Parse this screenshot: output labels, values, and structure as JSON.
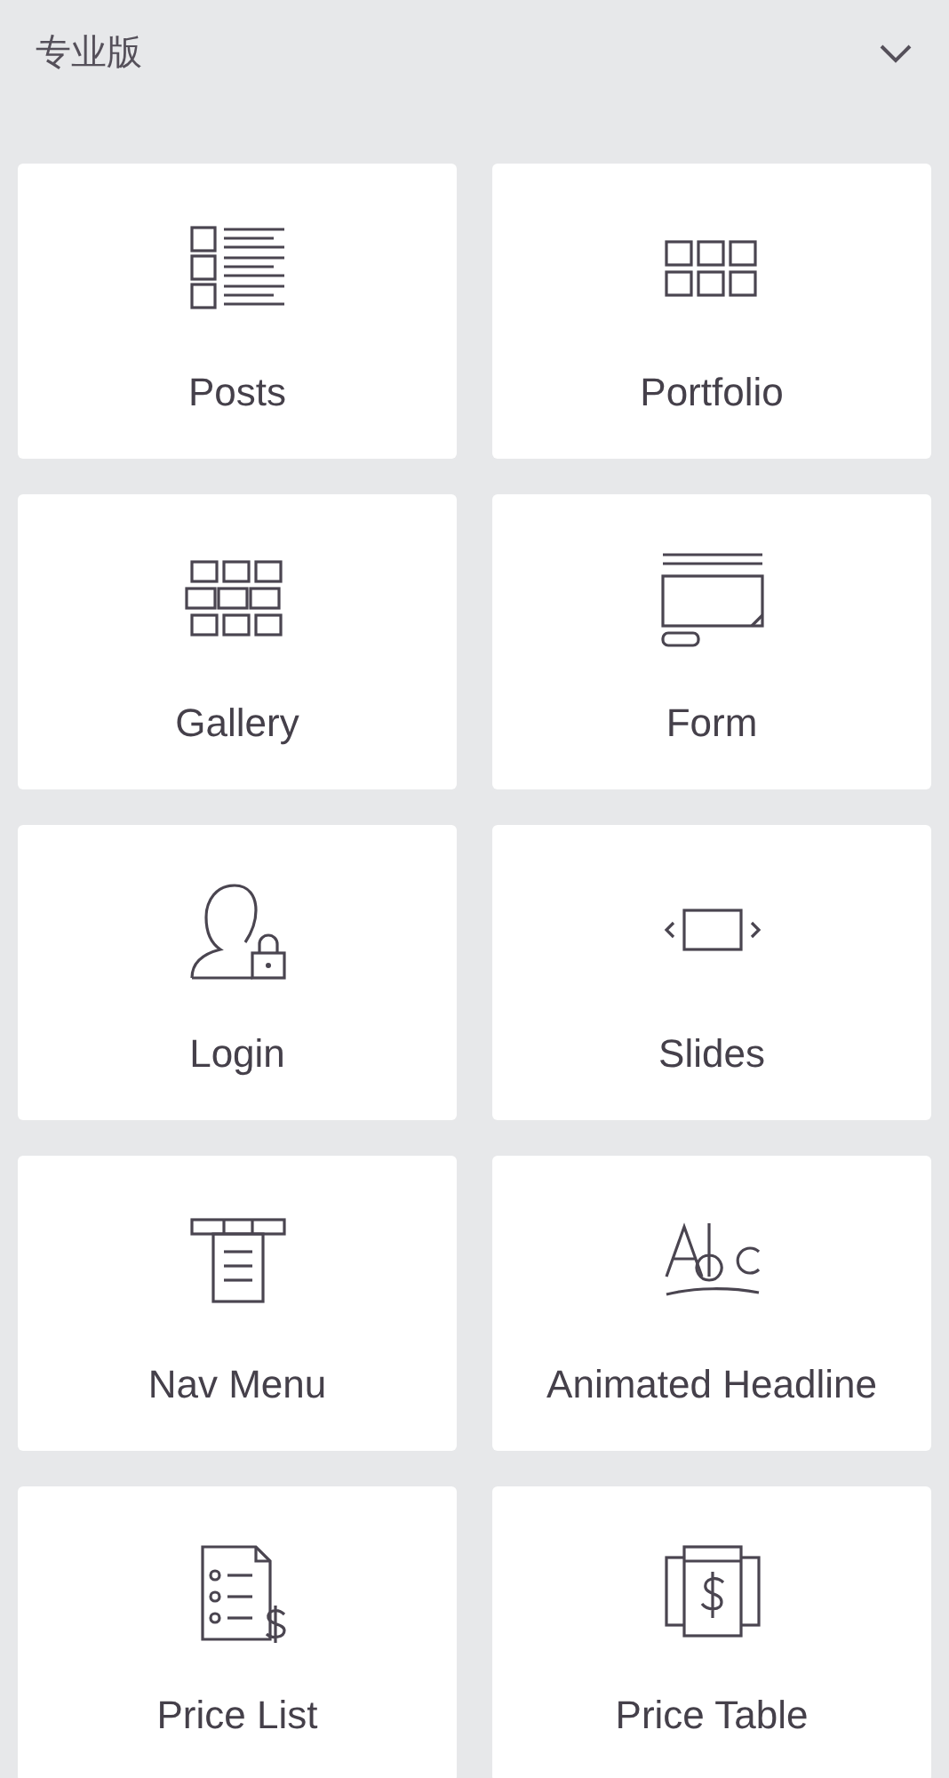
{
  "section": {
    "title": "专业版",
    "expanded": true
  },
  "widgets": [
    {
      "label": "Posts"
    },
    {
      "label": "Portfolio"
    },
    {
      "label": "Gallery"
    },
    {
      "label": "Form"
    },
    {
      "label": "Login"
    },
    {
      "label": "Slides"
    },
    {
      "label": "Nav Menu"
    },
    {
      "label": "Animated Headline"
    },
    {
      "label": "Price List"
    },
    {
      "label": "Price Table"
    }
  ]
}
